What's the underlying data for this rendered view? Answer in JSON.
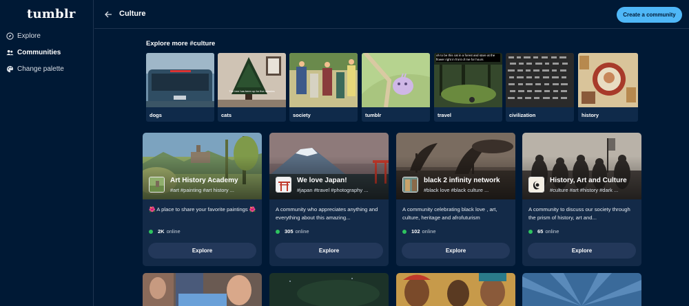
{
  "app": {
    "logo": "tumblr"
  },
  "sidebar": {
    "items": [
      {
        "label": "Explore",
        "icon": "compass-icon",
        "active": false
      },
      {
        "label": "Communities",
        "icon": "people-icon",
        "active": true
      },
      {
        "label": "Change palette",
        "icon": "palette-icon",
        "active": false
      }
    ]
  },
  "header": {
    "title": "Culture",
    "create_label": "Create a community"
  },
  "explore": {
    "title": "Explore more #culture",
    "tags": [
      {
        "label": "dogs"
      },
      {
        "label": "cats",
        "caption": "The tree has been up for five minutes"
      },
      {
        "label": "society"
      },
      {
        "label": "tumblr"
      },
      {
        "label": "travel",
        "caption": "oh to be this cat in a forest and stare at the flower right in front of me for hours"
      },
      {
        "label": "civilization"
      },
      {
        "label": "history"
      }
    ]
  },
  "communities": [
    {
      "name": "Art History Academy",
      "tags": "#art #painting #art history ...",
      "description": "🌺 A place to share your favorite paintings 🌺",
      "online_count": "2K",
      "online_label": "online",
      "button": "Explore"
    },
    {
      "name": "We love Japan!",
      "tags": "#japan #travel #photography ...",
      "description": "A community who appreciates anything and everything about this amazing...",
      "online_count": "305",
      "online_label": "online",
      "button": "Explore"
    },
    {
      "name": "black 2 infinity network",
      "tags": "#black love #black culture ...",
      "description": "A community celebrating black love , art, culture, heritage and afrofuturism",
      "online_count": "102",
      "online_label": "online",
      "button": "Explore"
    },
    {
      "name": "History, Art and Culture",
      "tags": "#culture #art #history #dark ...",
      "description": "A community to discuss our society through the prism of history, art and...",
      "online_count": "65",
      "online_label": "online",
      "button": "Explore"
    }
  ],
  "colors": {
    "background": "#001935",
    "accent": "#4fb7f7",
    "card": "#132a48",
    "online_dot": "#2ec45f"
  }
}
